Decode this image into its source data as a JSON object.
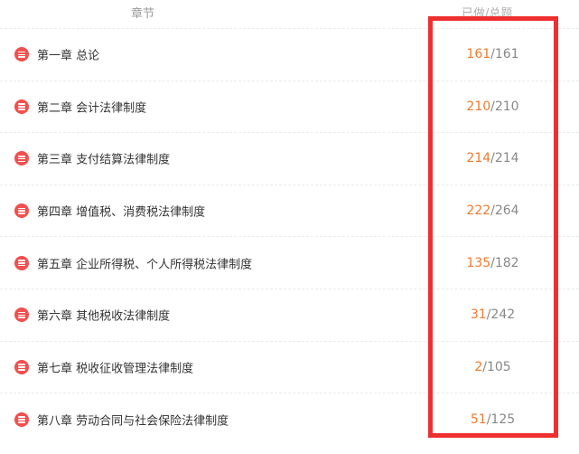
{
  "header": {
    "chapter_label": "章节",
    "progress_label": "已做/总题"
  },
  "chapters": [
    {
      "title": "第一章 总论",
      "done": "161",
      "separator": "/",
      "total": "161"
    },
    {
      "title": "第二章 会计法律制度",
      "done": "210",
      "separator": "/",
      "total": "210"
    },
    {
      "title": "第三章 支付结算法律制度",
      "done": "214",
      "separator": "/",
      "total": "214"
    },
    {
      "title": "第四章 增值税、消费税法律制度",
      "done": "222",
      "separator": "/",
      "total": "264"
    },
    {
      "title": "第五章 企业所得税、个人所得税法律制度",
      "done": "135",
      "separator": "/",
      "total": "182"
    },
    {
      "title": "第六章 其他税收法律制度",
      "done": "31",
      "separator": "/",
      "total": "242"
    },
    {
      "title": "第七章 税收征收管理法律制度",
      "done": "2",
      "separator": "/",
      "total": "105"
    },
    {
      "title": "第八章 劳动合同与社会保险法律制度",
      "done": "51",
      "separator": "/",
      "total": "125"
    }
  ],
  "colors": {
    "icon": "#f0504f",
    "done": "#f07a2c",
    "highlight_box": "#ee2f2f"
  },
  "icons": {
    "row_icon": "list-menu-icon"
  }
}
